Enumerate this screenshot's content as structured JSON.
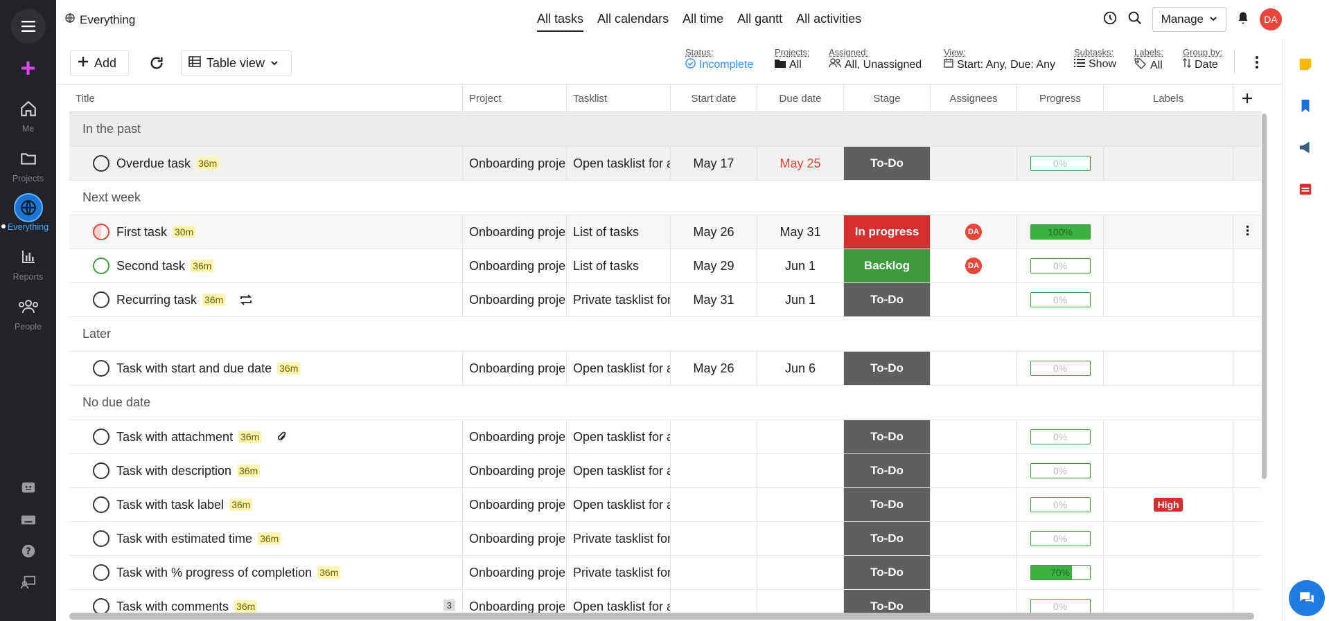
{
  "app": {
    "title": "Everything"
  },
  "sidebar": {
    "items": [
      {
        "label": "Me"
      },
      {
        "label": "Projects"
      },
      {
        "label": "Everything"
      },
      {
        "label": "Reports"
      },
      {
        "label": "People"
      }
    ]
  },
  "top_tabs": [
    "All tasks",
    "All calendars",
    "All time",
    "All gantt",
    "All activities"
  ],
  "manage_label": "Manage",
  "user_initials": "DA",
  "toolbar": {
    "add_label": "Add",
    "view_label": "Table view",
    "filters": [
      {
        "label": "Status:",
        "value": "Incomplete"
      },
      {
        "label": "Projects:",
        "value": "All"
      },
      {
        "label": "Assigned:",
        "value": "All, Unassigned"
      },
      {
        "label": "View:",
        "value": "Start: Any, Due: Any"
      },
      {
        "label": "Subtasks:",
        "value": "Show"
      },
      {
        "label": "Labels:",
        "value": "All"
      },
      {
        "label": "Group by:",
        "value": "Date"
      }
    ]
  },
  "columns": [
    "Title",
    "Project",
    "Tasklist",
    "Start date",
    "Due date",
    "Stage",
    "Assignees",
    "Progress",
    "Labels"
  ],
  "groups": [
    {
      "name": "In the past"
    },
    {
      "name": "Next week"
    },
    {
      "name": "Later"
    },
    {
      "name": "No due date"
    }
  ],
  "tasks": [
    {
      "title": "Overdue task",
      "estimate": "36m",
      "project": "Onboarding project",
      "tasklist": "Open tasklist for all",
      "start": "May 17",
      "due": "May 25",
      "stage": "To-Do",
      "assignee": "",
      "progress": "0%",
      "label": ""
    },
    {
      "title": "First task",
      "estimate": "30m",
      "project": "Onboarding project",
      "tasklist": "List of tasks",
      "start": "May 26",
      "due": "May 31",
      "stage": "In progress",
      "assignee": "DA",
      "progress": "100%",
      "label": ""
    },
    {
      "title": "Second task",
      "estimate": "36m",
      "project": "Onboarding project",
      "tasklist": "List of tasks",
      "start": "May 29",
      "due": "Jun 1",
      "stage": "Backlog",
      "assignee": "DA",
      "progress": "0%",
      "label": ""
    },
    {
      "title": "Recurring task",
      "estimate": "36m",
      "project": "Onboarding project",
      "tasklist": "Private tasklist for",
      "start": "May 31",
      "due": "Jun 1",
      "stage": "To-Do",
      "assignee": "",
      "progress": "0%",
      "label": ""
    },
    {
      "title": "Task with start and due date",
      "estimate": "36m",
      "project": "Onboarding project",
      "tasklist": "Open tasklist for all",
      "start": "May 26",
      "due": "Jun 6",
      "stage": "To-Do",
      "assignee": "",
      "progress": "0%",
      "label": ""
    },
    {
      "title": "Task with attachment",
      "estimate": "36m",
      "project": "Onboarding project",
      "tasklist": "Open tasklist for all",
      "start": "",
      "due": "",
      "stage": "To-Do",
      "assignee": "",
      "progress": "0%",
      "label": ""
    },
    {
      "title": "Task with description",
      "estimate": "36m",
      "project": "Onboarding project",
      "tasklist": "Open tasklist for all",
      "start": "",
      "due": "",
      "stage": "To-Do",
      "assignee": "",
      "progress": "0%",
      "label": ""
    },
    {
      "title": "Task with task label",
      "estimate": "36m",
      "project": "Onboarding project",
      "tasklist": "Open tasklist for all",
      "start": "",
      "due": "",
      "stage": "To-Do",
      "assignee": "",
      "progress": "0%",
      "label": "High"
    },
    {
      "title": "Task with estimated time",
      "estimate": "36m",
      "project": "Onboarding project",
      "tasklist": "Private tasklist for",
      "start": "",
      "due": "",
      "stage": "To-Do",
      "assignee": "",
      "progress": "0%",
      "label": ""
    },
    {
      "title": "Task with % progress of completion",
      "estimate": "36m",
      "project": "Onboarding project",
      "tasklist": "Private tasklist for",
      "start": "",
      "due": "",
      "stage": "To-Do",
      "assignee": "",
      "progress": "70%",
      "label": ""
    },
    {
      "title": "Task with comments",
      "estimate": "36m",
      "comments": "3",
      "project": "Onboarding project",
      "tasklist": "Open tasklist for all",
      "start": "",
      "due": "",
      "stage": "To-Do",
      "assignee": "",
      "progress": "0%",
      "label": ""
    }
  ],
  "progress_fractions": [
    0,
    1,
    0,
    0,
    0,
    0,
    0,
    0,
    0,
    0.7,
    0
  ],
  "colors": {
    "todo": "#5f5f5f",
    "in_progress": "#d32f2f",
    "backlog": "#3c9a3c",
    "accent": "#2e8ded",
    "avatar": "#e8453c"
  }
}
